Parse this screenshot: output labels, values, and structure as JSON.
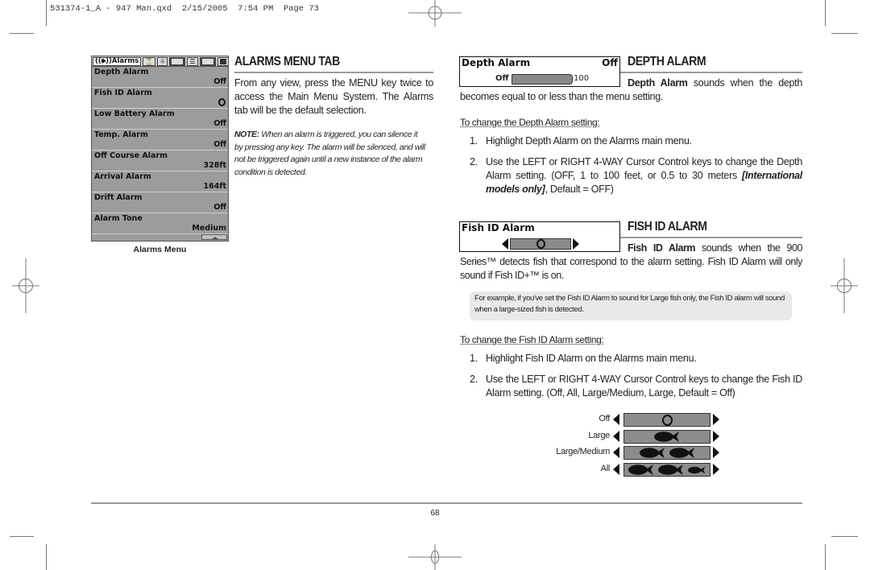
{
  "slug": "531374-1_A - 947 Man.qxd  2/15/2005  7:54 PM  Page 73",
  "alarms_menu": {
    "tabs": [
      {
        "label": "Alarms",
        "icon": "speaker-icon",
        "active": true
      },
      {
        "icon": "sonar-icon"
      },
      {
        "icon": "sun-icon"
      },
      {
        "icon": "chart-icon"
      },
      {
        "icon": "settings-sliders-icon"
      },
      {
        "icon": "sonar-view-icon"
      },
      {
        "icon": "accessory-icon"
      }
    ],
    "items": [
      {
        "label": "Depth Alarm",
        "value": "Off"
      },
      {
        "label": "Fish ID Alarm",
        "value": "",
        "icon": "fish-off-ring-icon"
      },
      {
        "label": "Low Battery Alarm",
        "value": "Off"
      },
      {
        "label": "Temp. Alarm",
        "value": "Off"
      },
      {
        "label": "Off Course Alarm",
        "value": "328ft"
      },
      {
        "label": "Arrival Alarm",
        "value": "164ft"
      },
      {
        "label": "Drift Alarm",
        "value": "Off"
      },
      {
        "label": "Alarm Tone",
        "value": "Medium"
      }
    ],
    "caption": "Alarms Menu"
  },
  "alarms_menu_tab": {
    "heading": "ALARMS MENU TAB",
    "body": "From any view, press the MENU key twice to access the Main Menu System. The Alarms tab will be the default selection.",
    "note_label": "NOTE:",
    "note": " When an alarm is triggered, you can silence it by pressing any key. The alarm will be silenced, and will not be triggered again until a new instance of the alarm condition is detected."
  },
  "depth_alarm": {
    "screen": {
      "title": "Depth Alarm",
      "value": "Off",
      "slider_min": "Off",
      "slider_max": "100"
    },
    "heading": "DEPTH ALARM",
    "body_bold": "Depth Alarm",
    "body": " sounds when the depth becomes equal to or less than the menu setting.",
    "subheading": "To change the Depth Alarm setting:",
    "steps": [
      {
        "num": "1.",
        "text": "Highlight Depth Alarm on the Alarms main menu."
      },
      {
        "num": "2.",
        "text": "Use the LEFT or RIGHT 4-WAY Cursor Control keys to change the Depth Alarm setting. (OFF, 1 to 100 feet, or 0.5 to 30 meters ",
        "italic": "[International models only]",
        "tail": ", Default = OFF)"
      }
    ]
  },
  "fish_id_alarm": {
    "screen": {
      "title": "Fish ID Alarm"
    },
    "heading": "FISH ID ALARM",
    "body_bold": "Fish ID Alarm",
    "body": " sounds when the 900 Series™ detects fish that correspond to the alarm setting. Fish ID Alarm will only sound if Fish ID+™ is on.",
    "example": "For example, if you've set the Fish ID Alarm to sound for Large fish only, the Fish ID alarm will sound when a large-sized fish is detected.",
    "subheading": "To change the Fish ID Alarm setting:",
    "steps": [
      {
        "num": "1.",
        "text": "Highlight Fish ID Alarm on the Alarms main menu."
      },
      {
        "num": "2.",
        "text": "Use the LEFT or RIGHT 4-WAY Cursor Control keys to change the Fish ID Alarm setting. (Off, All, Large/Medium, Large, Default = Off)"
      }
    ],
    "options": [
      {
        "label": "Off",
        "fish": []
      },
      {
        "label": "Large",
        "fish": [
          "large"
        ]
      },
      {
        "label": "Large/Medium",
        "fish": [
          "large",
          "large"
        ]
      },
      {
        "label": "All",
        "fish": [
          "large",
          "large",
          "small"
        ]
      }
    ]
  },
  "footer": {
    "page_number": "68"
  }
}
